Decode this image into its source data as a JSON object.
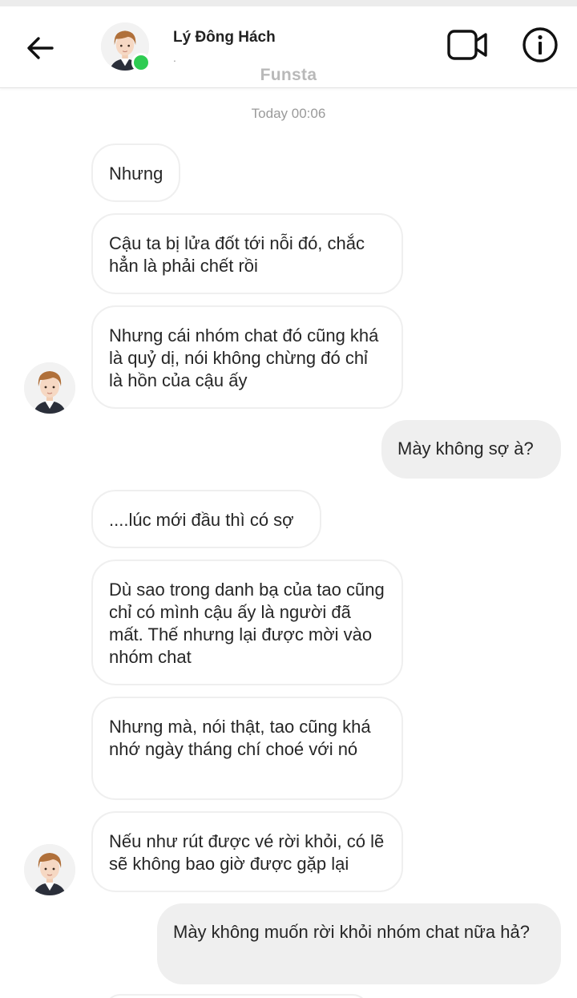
{
  "header": {
    "contact_name": "Lý Đông Hách",
    "contact_sub": ".",
    "watermark": "Funsta"
  },
  "icons": {
    "back": "arrow-left-icon",
    "video": "video-camera-icon",
    "info": "info-icon"
  },
  "colors": {
    "online": "#2ecc52",
    "incoming_bubble_border": "#efefef",
    "outgoing_bubble_bg": "#efefef"
  },
  "chat": {
    "timestamp": "Today 00:06",
    "messages": [
      {
        "from": "them",
        "text": "Nhưng"
      },
      {
        "from": "them",
        "text": "Cậu ta bị lửa đốt tới nỗi đó, chắc hẳn là phải chết rồi"
      },
      {
        "from": "them",
        "text": "Nhưng cái nhóm chat đó cũng khá là quỷ dị, nói không chừng đó chỉ là hồn của cậu ấy"
      },
      {
        "from": "me",
        "text": "Mày không sợ à?"
      },
      {
        "from": "them",
        "text": "....lúc mới đầu thì có sợ"
      },
      {
        "from": "them",
        "text": "Dù sao trong danh bạ của tao cũng chỉ có mình cậu ấy là người đã mất. Thế nhưng lại được mời vào nhóm chat"
      },
      {
        "from": "them",
        "text": "Nhưng mà, nói thật, tao cũng khá nhớ ngày tháng chí choé với nó"
      },
      {
        "from": "them",
        "text": "Nếu như rút được vé rời khỏi, có lẽ sẽ không bao giờ được gặp lại"
      },
      {
        "from": "me",
        "text": "Mày không muốn rời khỏi nhóm chat nữa hả?"
      }
    ]
  }
}
